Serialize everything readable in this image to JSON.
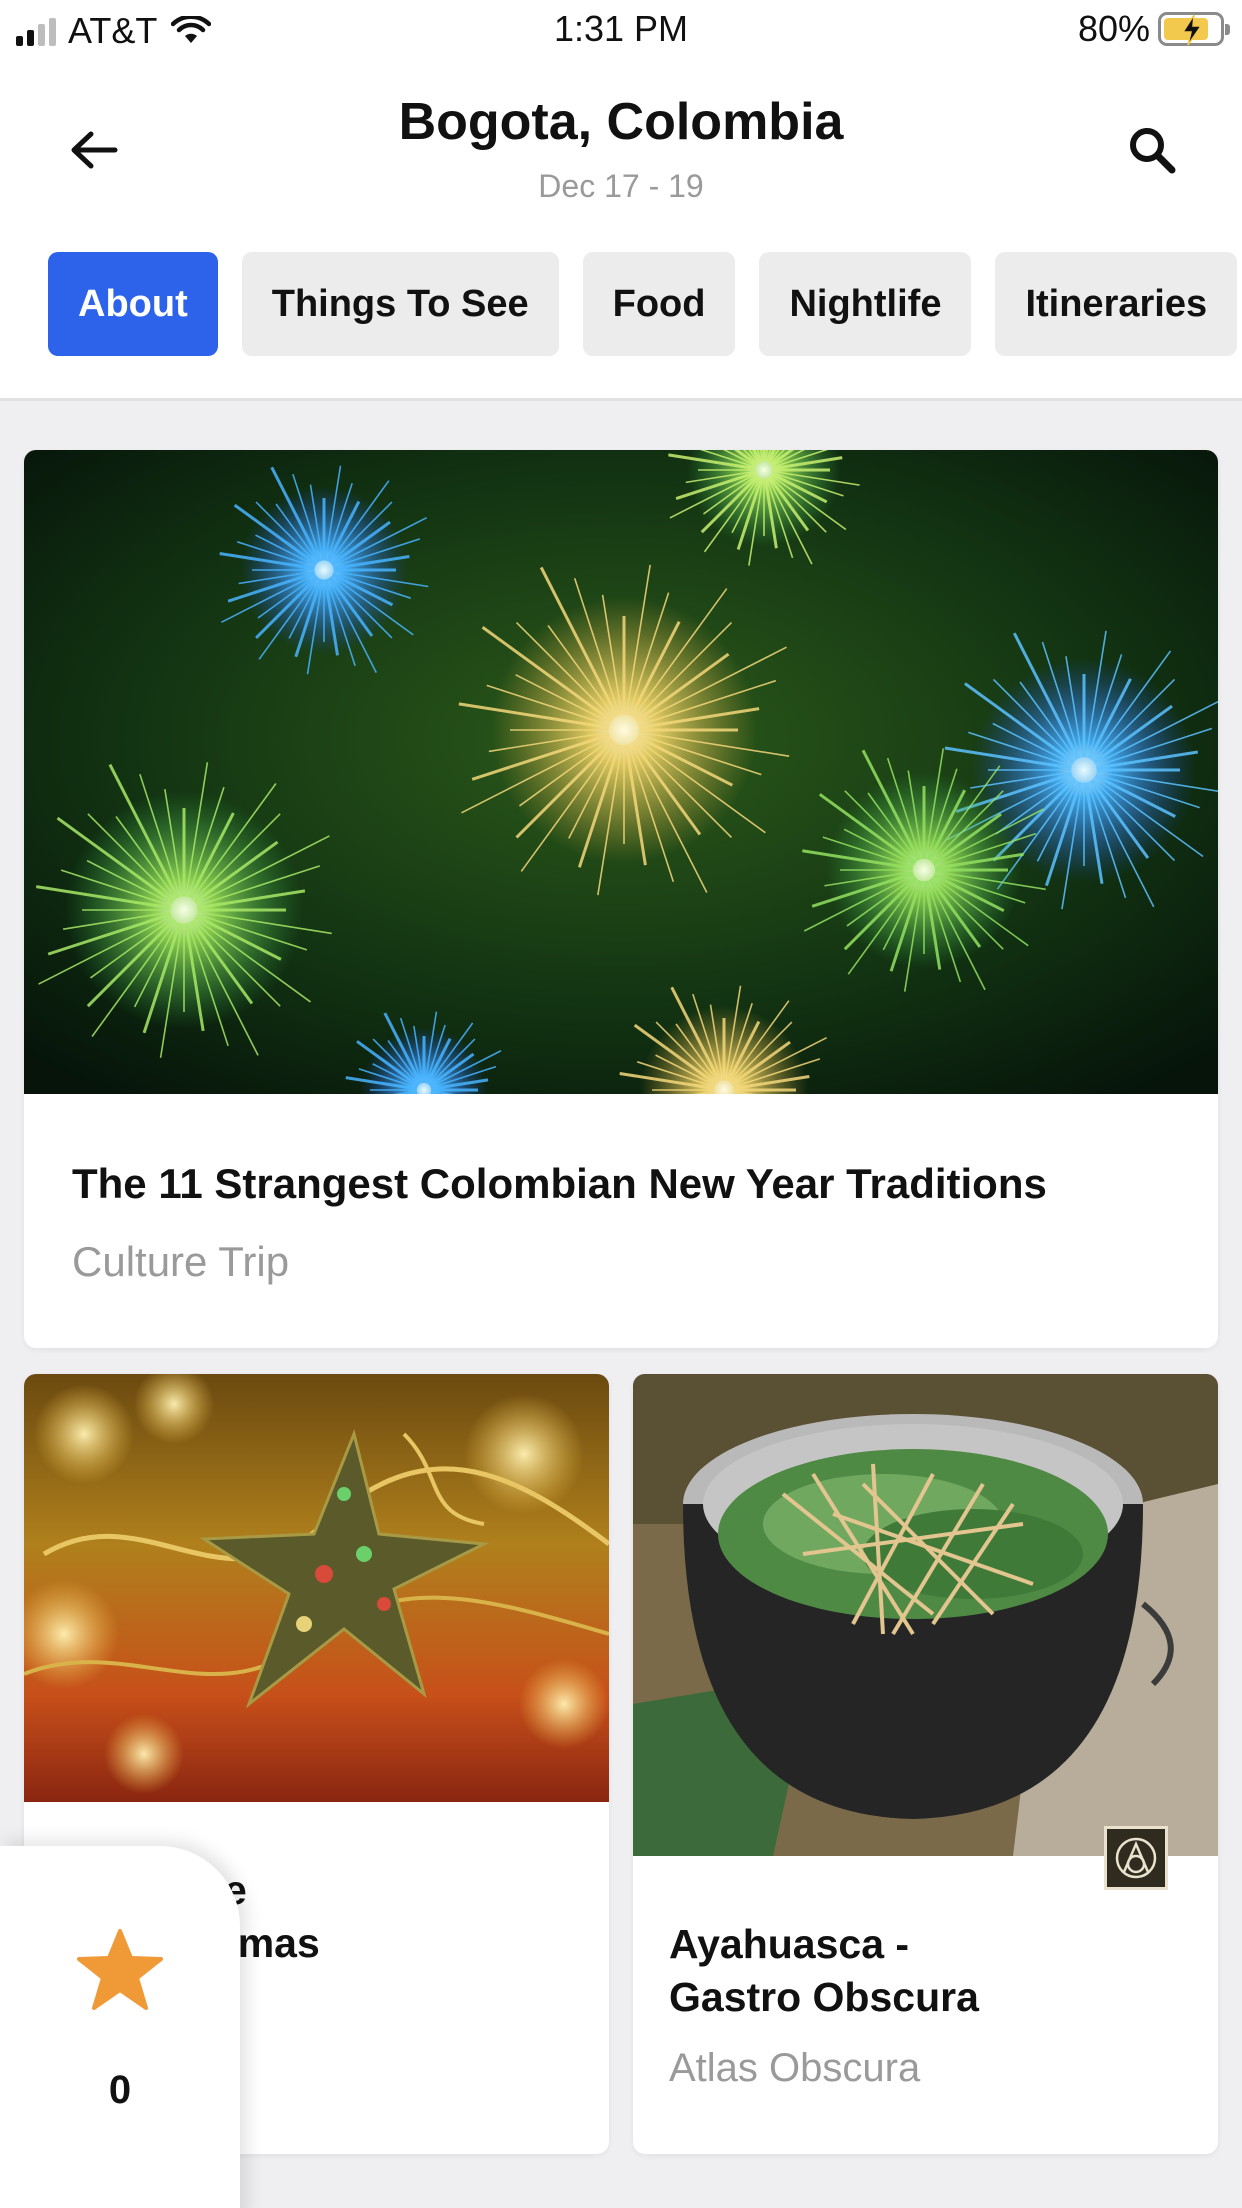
{
  "status_bar": {
    "carrier": "AT&T",
    "time": "1:31 PM",
    "battery": "80%",
    "icons": [
      "signal-icon",
      "wifi-icon",
      "battery-charging-icon"
    ]
  },
  "header": {
    "title": "Bogota, Colombia",
    "dates": "Dec 17 - 19",
    "back_icon": "arrow-left-icon",
    "search_icon": "search-icon"
  },
  "tabs": [
    {
      "label": "About",
      "active": true
    },
    {
      "label": "Things To See",
      "active": false
    },
    {
      "label": "Food",
      "active": false
    },
    {
      "label": "Nightlife",
      "active": false
    },
    {
      "label": "Itineraries",
      "active": false
    }
  ],
  "colors": {
    "accent": "#2d62ea",
    "star": "#f09a37",
    "muted_text": "#9a9a9a"
  },
  "articles": [
    {
      "title": "The 11 Strangest Colombian New Year Traditions",
      "source": "Culture Trip",
      "image": "fireworks-image"
    },
    {
      "title": "st Unique\nan Christmas",
      "image": "christmas-ornament-image"
    },
    {
      "title": "Ayahuasca -\nGastro Obscura",
      "source": "Atlas Obscura",
      "image": "ayahuasca-pot-image",
      "badge": "atlas-obscura-logo-icon"
    }
  ],
  "favorites": {
    "icon": "star-icon",
    "count": "0"
  }
}
